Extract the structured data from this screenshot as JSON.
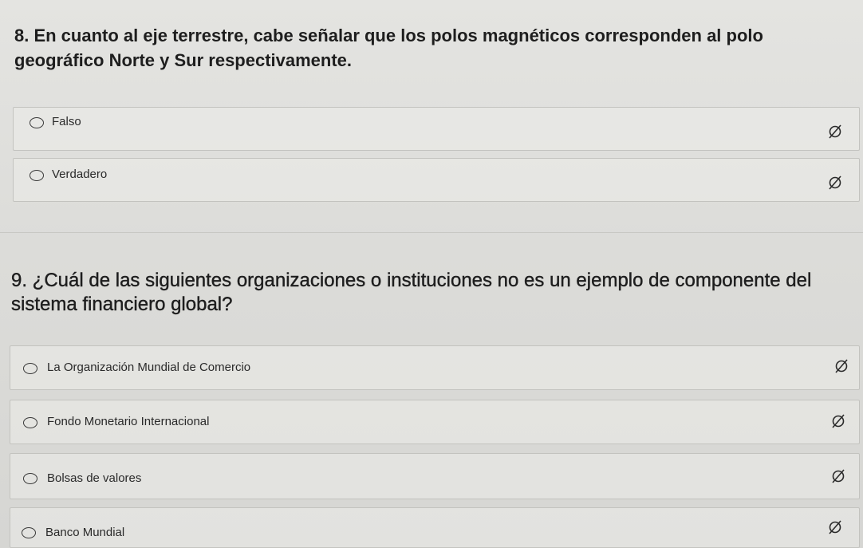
{
  "questions": [
    {
      "title": "8. En cuanto al eje terrestre, cabe señalar que los polos magnéticos corresponden al polo geográfico Norte y Sur respectivamente.",
      "options": [
        {
          "label": "Falso",
          "icon": "empty-set-clear-icon"
        },
        {
          "label": "Verdadero",
          "icon": "empty-set-clear-icon"
        }
      ]
    },
    {
      "title": "9. ¿Cuál de las siguientes organizaciones o instituciones no es un ejemplo de componente del sistema financiero global?",
      "options": [
        {
          "label": "La Organización Mundial de Comercio",
          "icon": "empty-set-clear-icon"
        },
        {
          "label": "Fondo Monetario Internacional",
          "icon": "empty-set-clear-icon"
        },
        {
          "label": "Bolsas de valores",
          "icon": "empty-set-clear-icon"
        },
        {
          "label": "Banco Mundial",
          "icon": "empty-set-clear-icon"
        }
      ]
    }
  ],
  "colors": {
    "text": "#1e1e1e",
    "border": "#c3c3bf",
    "background": "#dcdcd9"
  }
}
